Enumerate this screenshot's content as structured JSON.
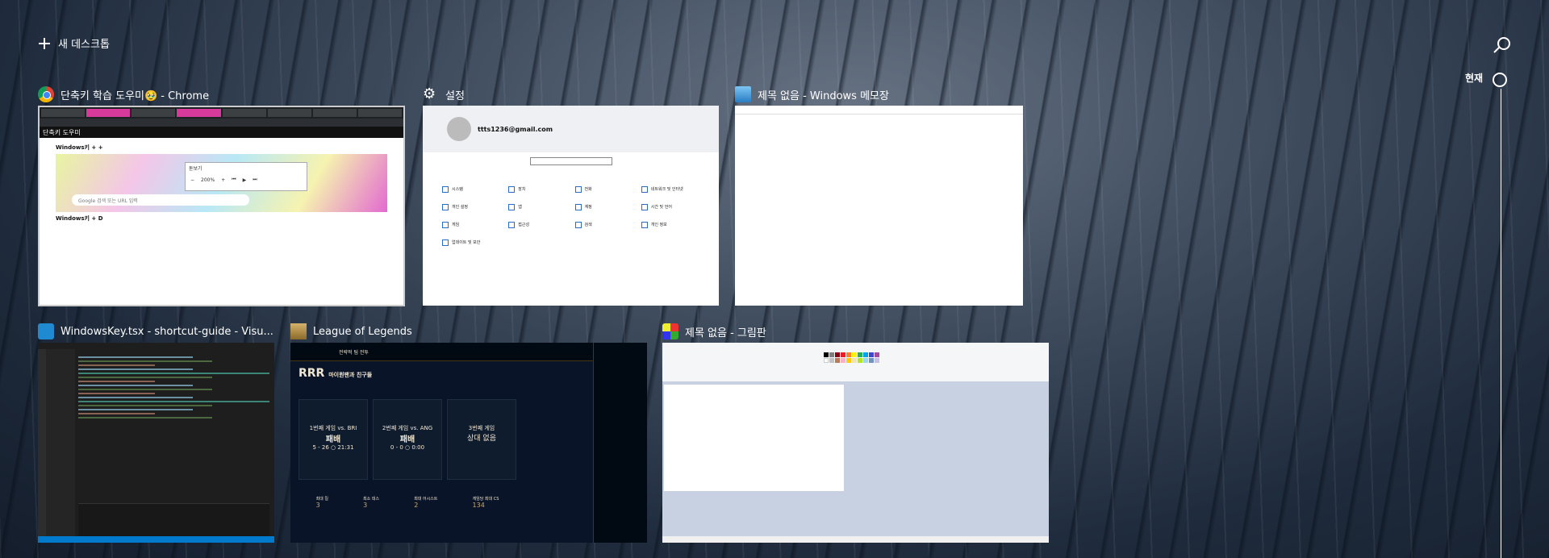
{
  "header": {
    "new_desktop_label": "새 데스크톱"
  },
  "timeline": {
    "now_label": "현재"
  },
  "windows": [
    {
      "title": "단축키 학습 도우미🥹 - Chrome",
      "content": {
        "page_header": "단축키 도우미",
        "section1": "Windows키 + +",
        "search_placeholder": "Google 검색 또는 URL 입력",
        "player_title": "돋보기",
        "zoom": "200%",
        "section2": "Windows키 + D"
      }
    },
    {
      "title": "설정",
      "content": {
        "email": "ttts1236@gmail.com",
        "items": [
          "시스템",
          "장치",
          "전화",
          "네트워크 및 인터넷",
          "개인 설정",
          "앱",
          "계정",
          "시간 및 언어",
          "게임",
          "접근성",
          "검색",
          "개인 정보",
          "업데이트 및 보안"
        ]
      }
    },
    {
      "title": "제목 없음 - Windows 메모장"
    },
    {
      "title": "WindowsKey.tsx - shortcut-guide - Visu..."
    },
    {
      "title": "League of Legends",
      "content": {
        "top": "전략적 팀 전투",
        "banner": "RRR",
        "banner_sub": "마이원팬과 친구들",
        "col1_head": "1번째 게임 vs. BRI",
        "col1_result": "패배",
        "col1_date": "5 - 26 ○ 21:31",
        "col2_head": "2번째 게임 vs. ANG",
        "col2_result": "패배",
        "col2_date": "0 - 0 ○ 0:00",
        "col3_head": "3번째 게임",
        "col3_result": "상대 없음",
        "stats": [
          "최대 킬",
          "최소 데스",
          "최대 어시스트",
          "게임당 최대 CS"
        ],
        "stat_values": [
          "3",
          "3",
          "2",
          "134"
        ]
      }
    },
    {
      "title": "제목 없음 - 그림판"
    }
  ],
  "colors": {
    "chrome_header": "#111111",
    "lol_gold": "#c8aa6e",
    "vscode_blue": "#007acc"
  }
}
